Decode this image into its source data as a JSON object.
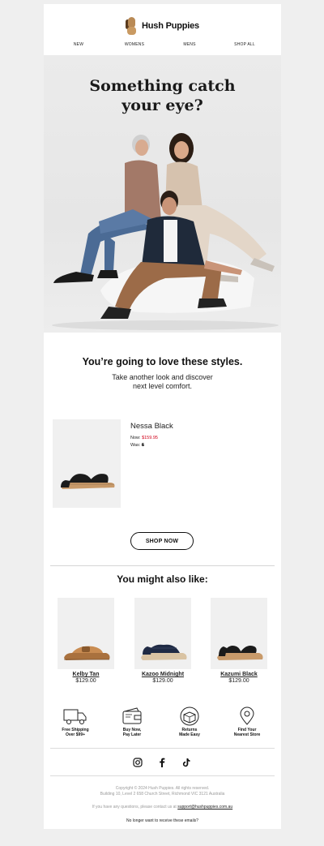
{
  "header": {
    "brand": "Hush Puppies",
    "nav": [
      "NEW",
      "WOMENS",
      "MENS",
      "SHOP ALL"
    ]
  },
  "hero": {
    "line1": "Something catch",
    "line2": "your eye?"
  },
  "intro": {
    "title": "You’re going to love these styles.",
    "line1": "Take another look and discover",
    "line2": "next level comfort."
  },
  "product": {
    "name": "Nessa Black",
    "now_label": "Now:",
    "now_price": "$159.95",
    "was_label": "Was:",
    "was_price": "$"
  },
  "cta": {
    "label": "SHOP NOW"
  },
  "recommendations": {
    "title": "You might also like:",
    "items": [
      {
        "name": "Kelby Tan",
        "price": "$129.00"
      },
      {
        "name": "Kazoo Midnight",
        "price": "$129.00"
      },
      {
        "name": "Kazumi Black",
        "price": "$129.00"
      }
    ]
  },
  "usps": [
    {
      "line1": "Free Shipping",
      "line2": "Over $99+",
      "icon": "truck-icon"
    },
    {
      "line1": "Buy Now,",
      "line2": "Pay Later",
      "icon": "wallet-icon"
    },
    {
      "line1": "Returns",
      "line2": "Made Easy",
      "icon": "returns-box-icon"
    },
    {
      "line1": "Find Your",
      "line2": "Nearest Store",
      "icon": "location-pin-icon"
    }
  ],
  "social": [
    "instagram-icon",
    "facebook-icon",
    "tiktok-icon"
  ],
  "footer": {
    "copyright": "Copyright © 2024 Hush Puppies. All rights reserved.",
    "address": "Building 10, Level 2 658 Church Street, Richmond VIC 3121 Australia",
    "contact_text": "If you have any questions, please contact us at",
    "email": "support@hushpuppies.com.au",
    "unsubscribe": "No longer want to receive these emails?"
  },
  "colors": {
    "sale_red": "#d0021b",
    "background": "#efefef"
  }
}
